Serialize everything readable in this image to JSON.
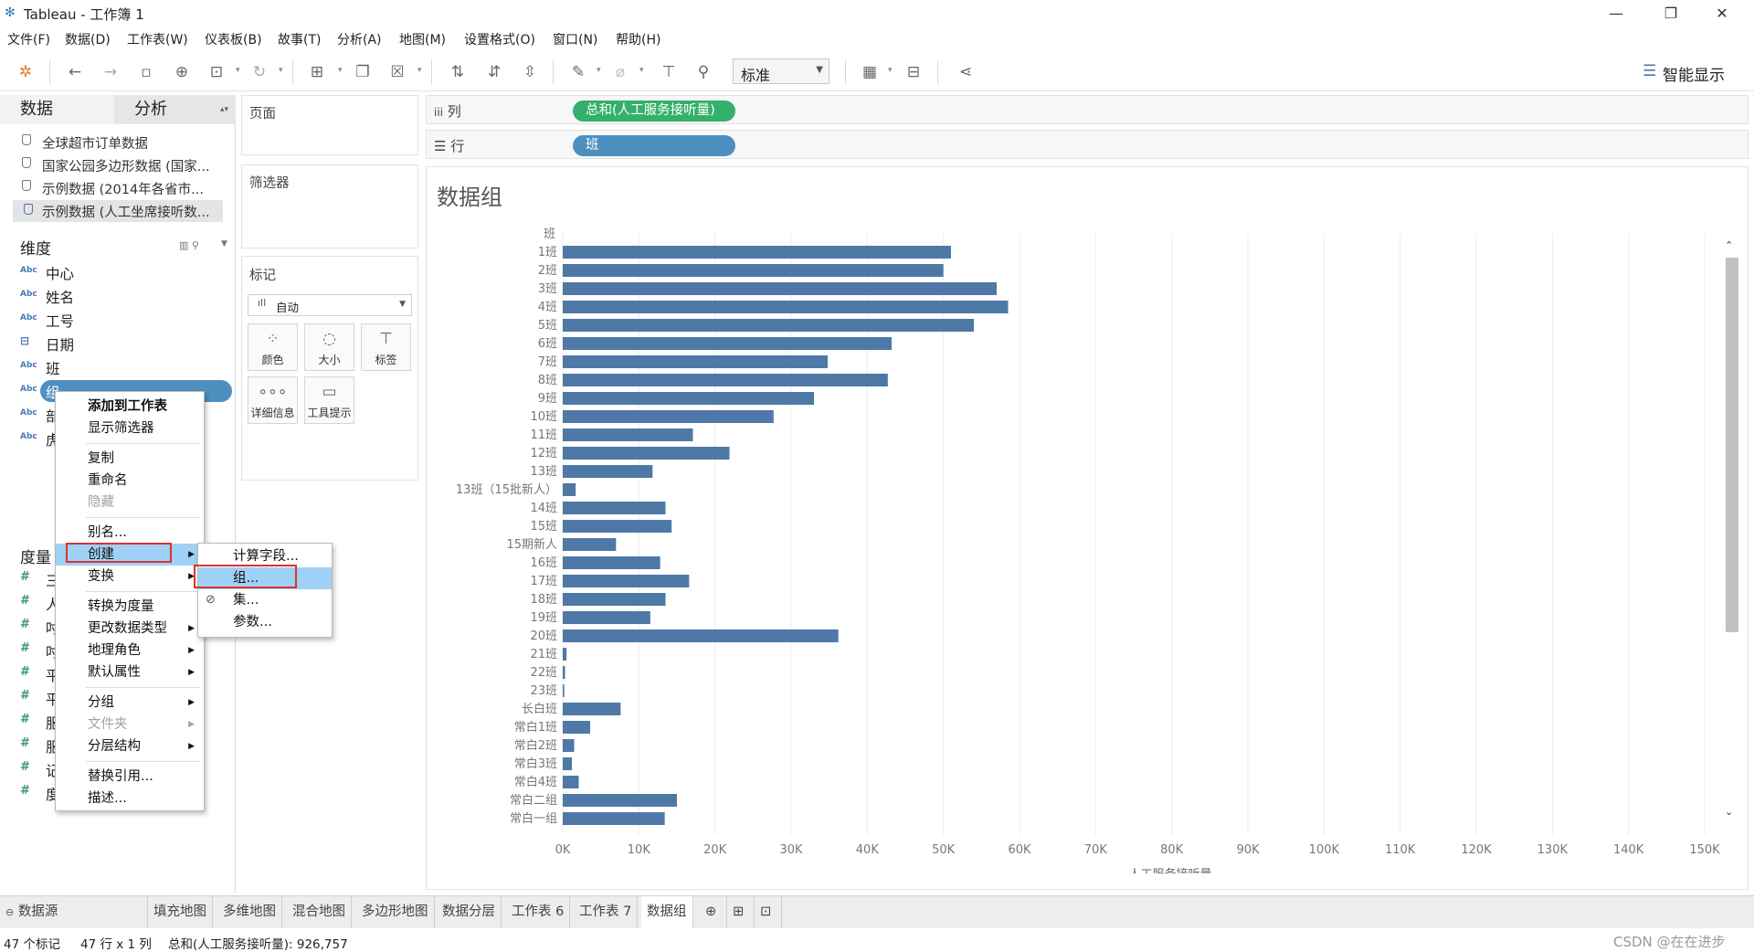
{
  "window": {
    "title": "Tableau - 工作簿 1",
    "minimize": "—",
    "restore": "❐",
    "close": "✕"
  },
  "menubar": [
    "文件(F)",
    "数据(D)",
    "工作表(W)",
    "仪表板(B)",
    "故事(T)",
    "分析(A)",
    "地图(M)",
    "设置格式(O)",
    "窗口(N)",
    "帮助(H)"
  ],
  "toolbar": {
    "fit_select": "标准",
    "show_me": "智能显示"
  },
  "left_pane": {
    "tab_data": "数据",
    "tab_analysis": "分析",
    "sources": [
      "全球超市订单数据",
      "国家公园多边形数据 (国家...",
      "示例数据 (2014年各省市...",
      "示例数据 (人工坐席接听数..."
    ],
    "dimensions_header": "维度",
    "dimensions": [
      {
        "type": "Abc",
        "name": "中心"
      },
      {
        "type": "Abc",
        "name": "姓名"
      },
      {
        "type": "Abc",
        "name": "工号"
      },
      {
        "type": "date",
        "name": "日期"
      },
      {
        "type": "Abc",
        "name": "班"
      },
      {
        "type": "Abc",
        "name": "组"
      },
      {
        "type": "Abc",
        "name": "部"
      },
      {
        "type": "Abc",
        "name": "虎"
      }
    ],
    "measures_header": "度量",
    "measures": [
      "三",
      "人",
      "吋",
      "吋",
      "平",
      "平",
      "服",
      "服",
      "记",
      "度"
    ]
  },
  "shelves": {
    "pages": "页面",
    "filters": "筛选器",
    "marks": "标记",
    "columns_label": "列",
    "rows_label": "行",
    "columns_pill": "总和(人工服务接听量)",
    "rows_pill": "班"
  },
  "marks": {
    "type": "自动",
    "buttons": [
      "颜色",
      "大小",
      "标签",
      "详细信息",
      "工具提示"
    ]
  },
  "context_menu": {
    "items": [
      {
        "label": "添加到工作表",
        "bold": true
      },
      {
        "label": "显示筛选器"
      },
      {
        "sep": true
      },
      {
        "label": "复制"
      },
      {
        "label": "重命名"
      },
      {
        "label": "隐藏",
        "disabled": true
      },
      {
        "sep": true
      },
      {
        "label": "别名..."
      },
      {
        "label": "创建",
        "submenu": true,
        "highlight": true
      },
      {
        "label": "变换",
        "submenu": true
      },
      {
        "sep": true
      },
      {
        "label": "转换为度量"
      },
      {
        "label": "更改数据类型",
        "submenu": true
      },
      {
        "label": "地理角色",
        "submenu": true
      },
      {
        "label": "默认属性",
        "submenu": true
      },
      {
        "sep": true
      },
      {
        "label": "分组",
        "submenu": true
      },
      {
        "label": "文件夹",
        "submenu": true,
        "disabled": true
      },
      {
        "label": "分层结构",
        "submenu": true
      },
      {
        "sep": true
      },
      {
        "label": "替换引用..."
      },
      {
        "label": "描述..."
      }
    ]
  },
  "submenu": {
    "items": [
      "计算字段...",
      "组...",
      "集...",
      "参数..."
    ]
  },
  "viz": {
    "title": "数据组"
  },
  "chart_data": {
    "type": "bar",
    "orientation": "horizontal",
    "row_header": "班",
    "xlabel": "人工服务接听量",
    "xlim": [
      0,
      150000
    ],
    "xticks": [
      "0K",
      "10K",
      "20K",
      "30K",
      "40K",
      "50K",
      "60K",
      "70K",
      "80K",
      "90K",
      "100K",
      "110K",
      "120K",
      "130K",
      "140K",
      "150K"
    ],
    "color": "#4e79a7",
    "categories": [
      "1班",
      "2班",
      "3班",
      "4班",
      "5班",
      "6班",
      "7班",
      "8班",
      "9班",
      "10班",
      "11班",
      "12班",
      "13班",
      "13班（15批新人）",
      "14班",
      "15班",
      "15期新人",
      "16班",
      "17班",
      "18班",
      "19班",
      "20班",
      "21班",
      "22班",
      "23班",
      "长白班",
      "常白1班",
      "常白2班",
      "常白3班",
      "常白4班",
      "常白二组",
      "常白一组"
    ],
    "values": [
      51000,
      50000,
      57000,
      58500,
      54000,
      43200,
      34800,
      42700,
      33000,
      27700,
      17100,
      21900,
      11800,
      1700,
      13500,
      14300,
      7000,
      12800,
      16600,
      13500,
      11500,
      36200,
      500,
      300,
      200,
      7600,
      3600,
      1500,
      1200,
      2100,
      15000,
      13400
    ]
  },
  "bottom_tabs": [
    "数据源",
    "填充地图",
    "多维地图",
    "混合地图",
    "多边形地图",
    "数据分层",
    "工作表 6",
    "工作表 7",
    "数据组"
  ],
  "status": {
    "marks": "47 个标记",
    "rows": "47 行 x 1 列",
    "sum": "总和(人工服务接听量): 926,757",
    "watermark": "CSDN @在在进步"
  }
}
